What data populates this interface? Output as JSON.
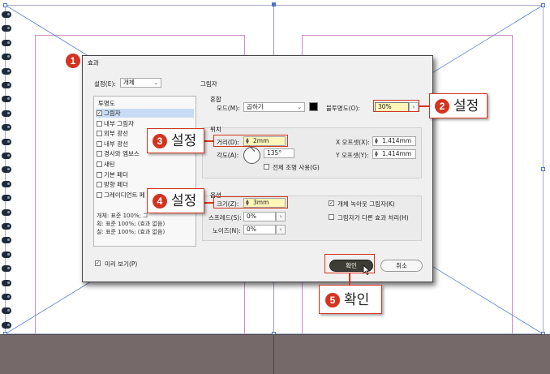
{
  "dialog": {
    "title": "효과",
    "settings_label": "설정(E):",
    "settings_value": "개체",
    "section_label": "그림자",
    "list_header": "투명도",
    "effects": [
      {
        "label": "그림자",
        "checked": true,
        "selected": true
      },
      {
        "label": "내부 그림자",
        "checked": false,
        "selected": false
      },
      {
        "label": "외부 광선",
        "checked": false,
        "selected": false
      },
      {
        "label": "내부 광선",
        "checked": false,
        "selected": false
      },
      {
        "label": "경사와 엠보스",
        "checked": false,
        "selected": false
      },
      {
        "label": "새틴",
        "checked": false,
        "selected": false
      },
      {
        "label": "기본 페더",
        "checked": false,
        "selected": false
      },
      {
        "label": "방향 페더",
        "checked": false,
        "selected": false
      },
      {
        "label": "그레이디언트 페",
        "checked": false,
        "selected": false
      }
    ],
    "summary": [
      "개체: 표준 100%; 그",
      "획: 표준 100%; (효과 없음)",
      "칠: 표준 100%; (효과 없음)"
    ],
    "blend": {
      "header": "혼합",
      "mode_label": "모드(M):",
      "mode_value": "곱하기",
      "swatch_color": "#000000",
      "opacity_label": "불투명도(O):",
      "opacity_value": "30%"
    },
    "position": {
      "header": "위치",
      "distance_label": "거리(D):",
      "distance_value": "2mm",
      "angle_label": "각도(A):",
      "angle_value": "135°",
      "global_light_label": "전체 조명 사용(G)",
      "x_offset_label": "X 오프셋(X):",
      "x_offset_value": "1.414mm",
      "y_offset_label": "Y 오프셋(Y):",
      "y_offset_value": "1.414mm"
    },
    "options": {
      "header": "옵션",
      "size_label": "크기(Z):",
      "size_value": "3mm",
      "spread_label": "스프레드(S):",
      "spread_value": "0%",
      "noise_label": "노이즈(N):",
      "noise_value": "0%",
      "knockout_label": "개체 녹아웃 그림자(K)",
      "knockout_checked": true,
      "honor_label": "그림자가 다른 효과 처리(H)",
      "honor_checked": false
    },
    "preview_label": "미리 보기(P)",
    "preview_checked": true,
    "ok_label": "확인",
    "cancel_label": "취소"
  },
  "callouts": {
    "step1": "1",
    "step2": "2",
    "step2_text": "설정",
    "step3": "3",
    "step3_text": "설정",
    "step4": "4",
    "step4_text": "설정",
    "step5": "5",
    "step5_text": "확인"
  },
  "colors": {
    "accent": "#d4341f",
    "highlight": "#fff6b8",
    "pasteboard": "#756a69",
    "margin_guide": "#c98fc5"
  }
}
